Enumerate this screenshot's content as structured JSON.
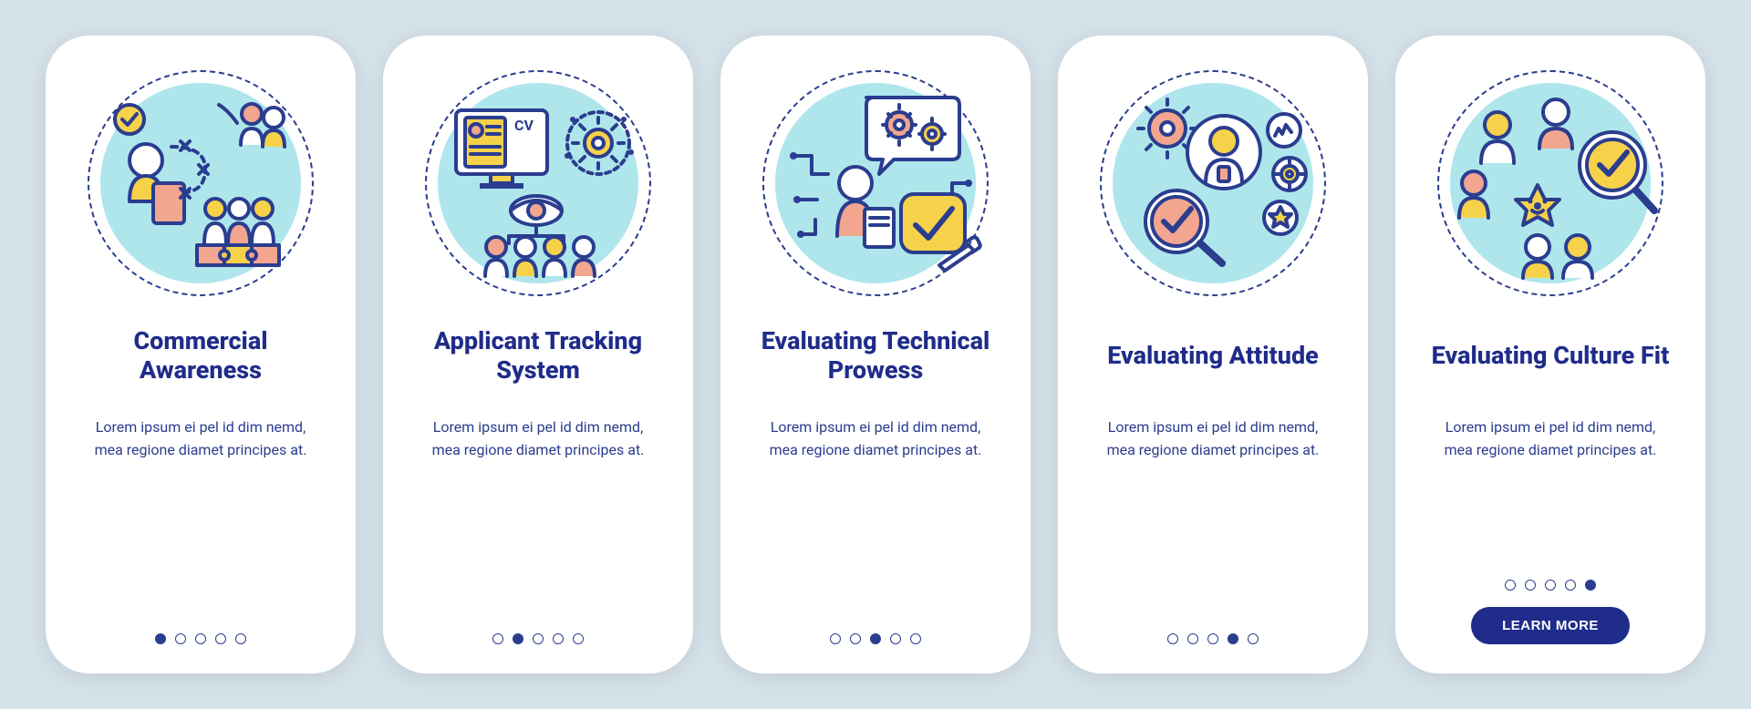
{
  "lorem": "Lorem ipsum ei pel id dim nemd, mea regione diamet principes at.",
  "learn_more": "LEARN MORE",
  "cards": [
    {
      "title": "Commercial Awareness"
    },
    {
      "title": "Applicant Tracking System"
    },
    {
      "title": "Evaluating Technical Prowess"
    },
    {
      "title": "Evaluating Attitude"
    },
    {
      "title": "Evaluating Culture Fit"
    }
  ],
  "colors": {
    "navy": "#2b3d8f",
    "coral": "#f2a58f",
    "yellow": "#f6d24a",
    "teal": "#aee6ec"
  }
}
